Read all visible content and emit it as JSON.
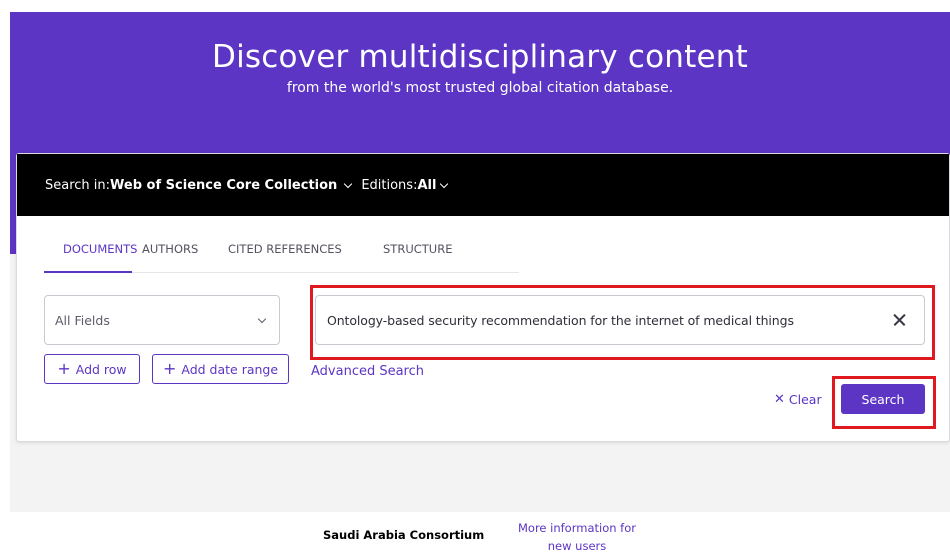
{
  "hero": {
    "title": "Discover multidisciplinary content",
    "subtitle": "from the world's most trusted global citation database."
  },
  "search_header": {
    "search_in_label": "Search in: ",
    "collection": "Web of Science Core Collection",
    "editions_label": "Editions: ",
    "editions_value": "All"
  },
  "tabs": [
    {
      "label": "DOCUMENTS",
      "active": true
    },
    {
      "label": "AUTHORS",
      "active": false
    },
    {
      "label": "CITED REFERENCES",
      "active": false
    },
    {
      "label": "STRUCTURE",
      "active": false
    }
  ],
  "search_form": {
    "field_select": "All Fields",
    "query_value": "Ontology-based security recommendation for the internet of medical things",
    "add_row_label": "Add row",
    "add_date_range_label": "Add date range",
    "advanced_search_label": "Advanced Search",
    "clear_label": "Clear",
    "search_label": "Search"
  },
  "footer": {
    "organization": "Saudi Arabia Consortium",
    "more_info_link": "More information for new users"
  },
  "colors": {
    "brand": "#5c35c4",
    "highlight": "#e0181f",
    "header_bg": "#000000"
  },
  "icons": [
    "chevron-down-icon",
    "close-icon",
    "plus-icon",
    "clear-x-icon"
  ]
}
